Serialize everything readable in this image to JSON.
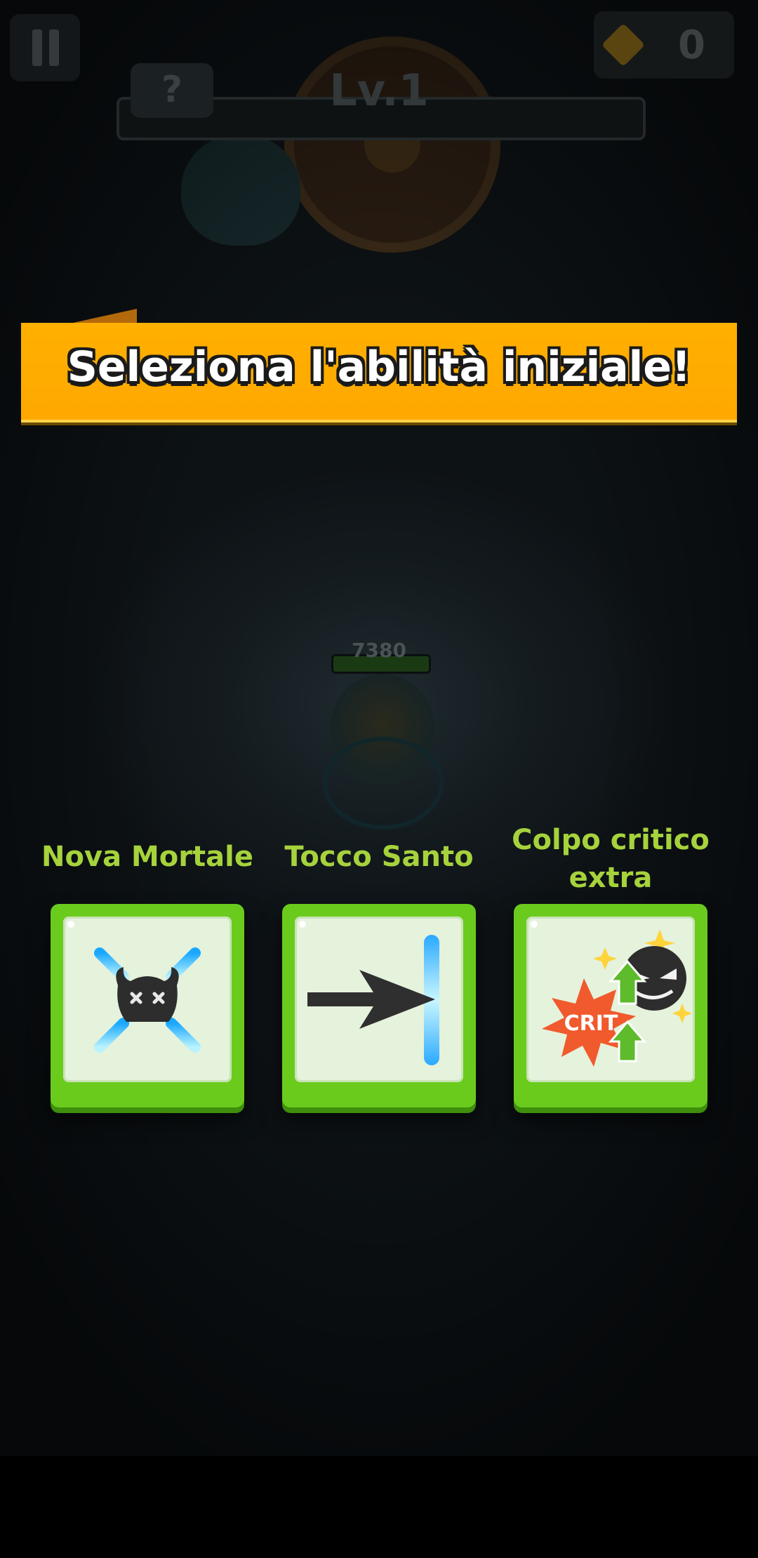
{
  "hud": {
    "gem_count": "0",
    "help_label": "?",
    "level_label": "Lv.1"
  },
  "boss": {
    "hp_value": "7380"
  },
  "banner": {
    "title": "Seleziona l'abilità iniziale!"
  },
  "skills": [
    {
      "name": "Nova Mortale",
      "icon": "death-nova-icon"
    },
    {
      "name": "Tocco Santo",
      "icon": "holy-touch-icon"
    },
    {
      "name": "Colpo critico extra",
      "icon": "crit-boost-icon",
      "badge": "CRIT"
    }
  ],
  "colors": {
    "banner": "#ffb000",
    "skill_name": "#a6d23c",
    "card_border": "#6acb1d",
    "card_face": "#e5f2dc"
  }
}
